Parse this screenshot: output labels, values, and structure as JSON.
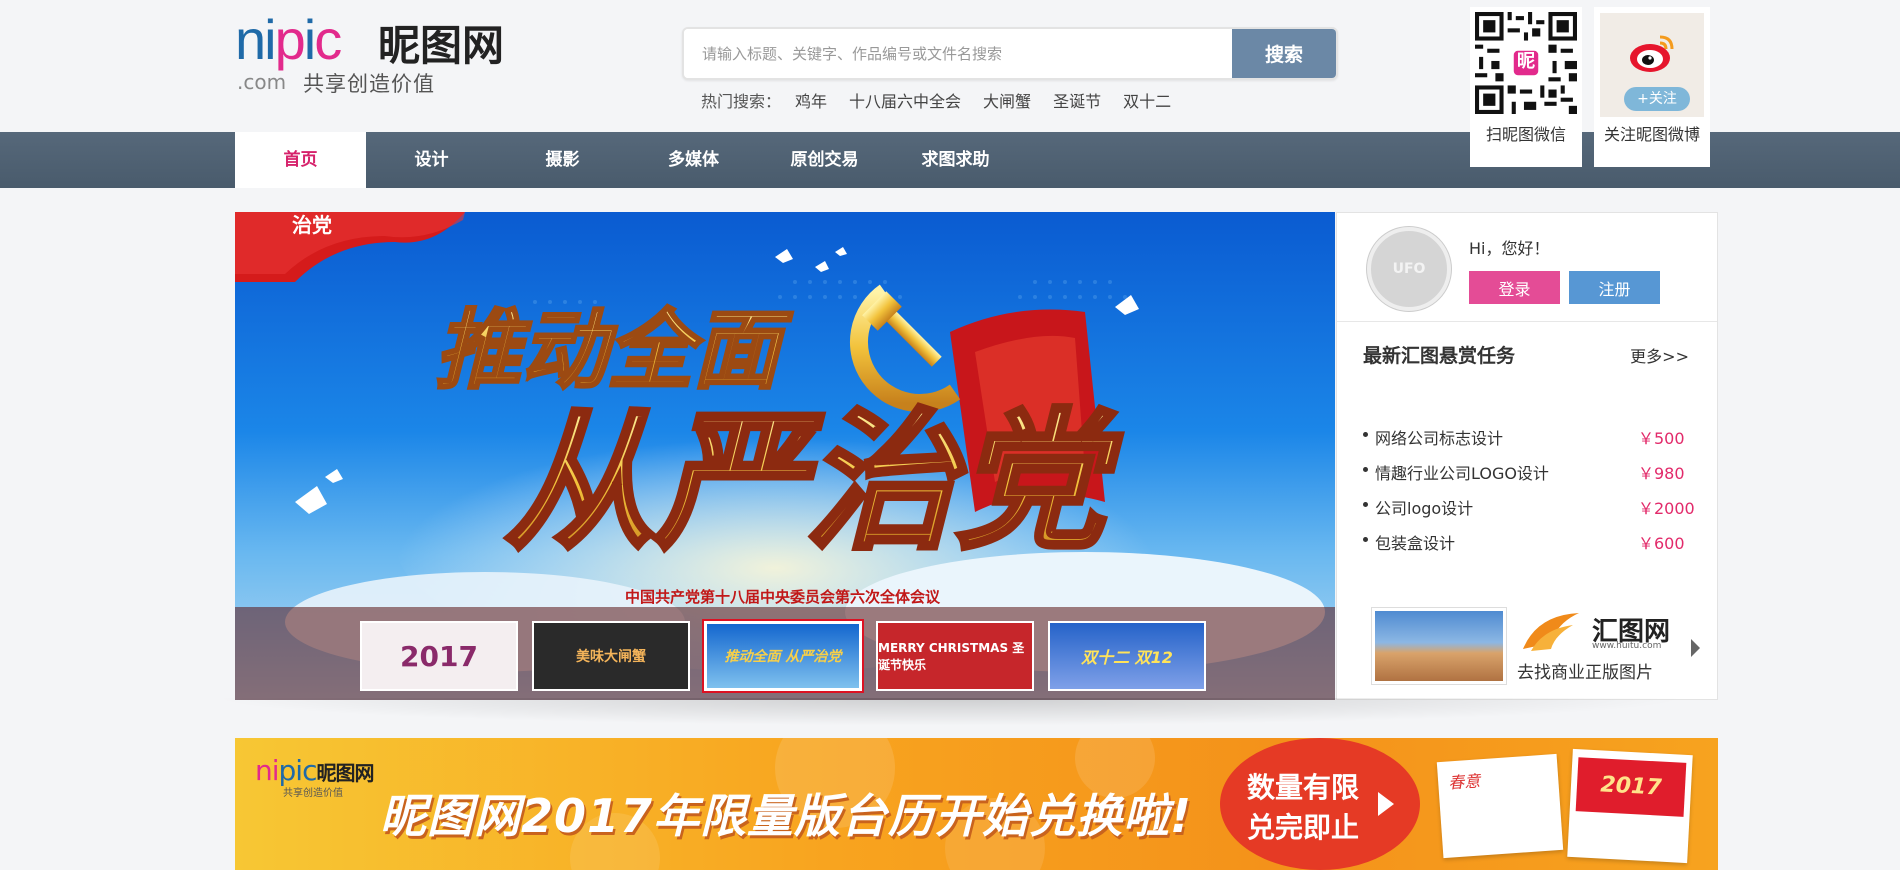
{
  "logo": {
    "nipic_n_i": "ni",
    "nipic_p": "p",
    "nipic_i": "i",
    "nipic_c": "c",
    "cn_name": "昵图网",
    "com": ".com",
    "slogan": "共享创造价值"
  },
  "search": {
    "placeholder": "请输入标题、关键字、作品编号或文件名搜索",
    "button": "搜索",
    "hot_label": "热门搜索：",
    "hot_terms": [
      "鸡年",
      "十八届六中全会",
      "大闸蟹",
      "圣诞节",
      "双十二"
    ]
  },
  "social": {
    "qr_logo_char": "昵",
    "wechat_label": "扫昵图微信",
    "weibo_follow": "+关注",
    "weibo_label": "关注昵图微博"
  },
  "nav": {
    "items": [
      "首页",
      "设计",
      "摄影",
      "多媒体",
      "原创交易",
      "求图求助"
    ],
    "active_index": 0
  },
  "banner": {
    "top_tag": "治党",
    "line1": "推动全面",
    "line2": "从严治党",
    "caption": "中国共产党第十八届中央委员会第六次全体会议",
    "thumbnails": [
      "2017",
      "美味大闸蟹",
      "推动全面 从严治党",
      "MERRY CHRISTMAS 圣诞节快乐",
      "双十二 双12"
    ],
    "active_thumb": 2
  },
  "user": {
    "avatar_text": "UFO",
    "greeting": "Hi，您好！",
    "login": "登录",
    "register": "注册"
  },
  "tasks": {
    "title": "最新汇图悬赏任务",
    "more": "更多>>",
    "items": [
      {
        "name": "网络公司标志设计",
        "price": "￥500"
      },
      {
        "name": "情趣行业公司LOGO设计",
        "price": "￥980"
      },
      {
        "name": "公司logo设计",
        "price": "￥2000"
      },
      {
        "name": "包装盒设计",
        "price": "￥600"
      }
    ]
  },
  "huitu": {
    "name": "汇图网",
    "url": "www.huitu.com",
    "sub": "去找商业正版图片"
  },
  "promo": {
    "logo_ni": "ni",
    "logo_pic": "pic",
    "logo_cn": "昵图网",
    "slogan": "共享创造价值",
    "title": "昵图网2017年限量版台历开始兑换啦!",
    "badge_line1": "数量有限",
    "badge_line2": "兑完即止",
    "cal1_text": "春意",
    "cal2_text": "2017"
  },
  "colors": {
    "brand_blue": "#1f6aa8",
    "brand_pink": "#e22a8c",
    "nav_bg": "#4f6173",
    "search_btn": "#6b88a6",
    "login_btn": "#e44c96",
    "register_btn": "#5797d4",
    "price": "#e22a6a"
  }
}
